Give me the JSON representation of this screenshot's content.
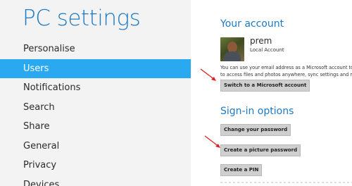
{
  "nav": {
    "title": "PC settings",
    "items": [
      {
        "label": "Personalise"
      },
      {
        "label": "Users"
      },
      {
        "label": "Notifications"
      },
      {
        "label": "Search"
      },
      {
        "label": "Share"
      },
      {
        "label": "General"
      },
      {
        "label": "Privacy"
      },
      {
        "label": "Devices"
      }
    ],
    "selected": "Users"
  },
  "account": {
    "title": "Your account",
    "user_name": "prem",
    "account_type": "Local Account",
    "description_line1": "You can use your email address as a Microsoft account to",
    "description_line2": "to access files and photos anywhere, sync settings and mo",
    "switch_button": "Switch to a Microsoft account"
  },
  "signin": {
    "title": "Sign-in options",
    "change_password_button": "Change your password",
    "picture_password_button": "Create a picture password",
    "pin_button": "Create a PIN"
  },
  "colors": {
    "accent": "#1d7ac4",
    "selected_bg": "#2aa8f0",
    "nav_bg": "#f3f3f3",
    "annotation_arrow": "#e02020"
  }
}
